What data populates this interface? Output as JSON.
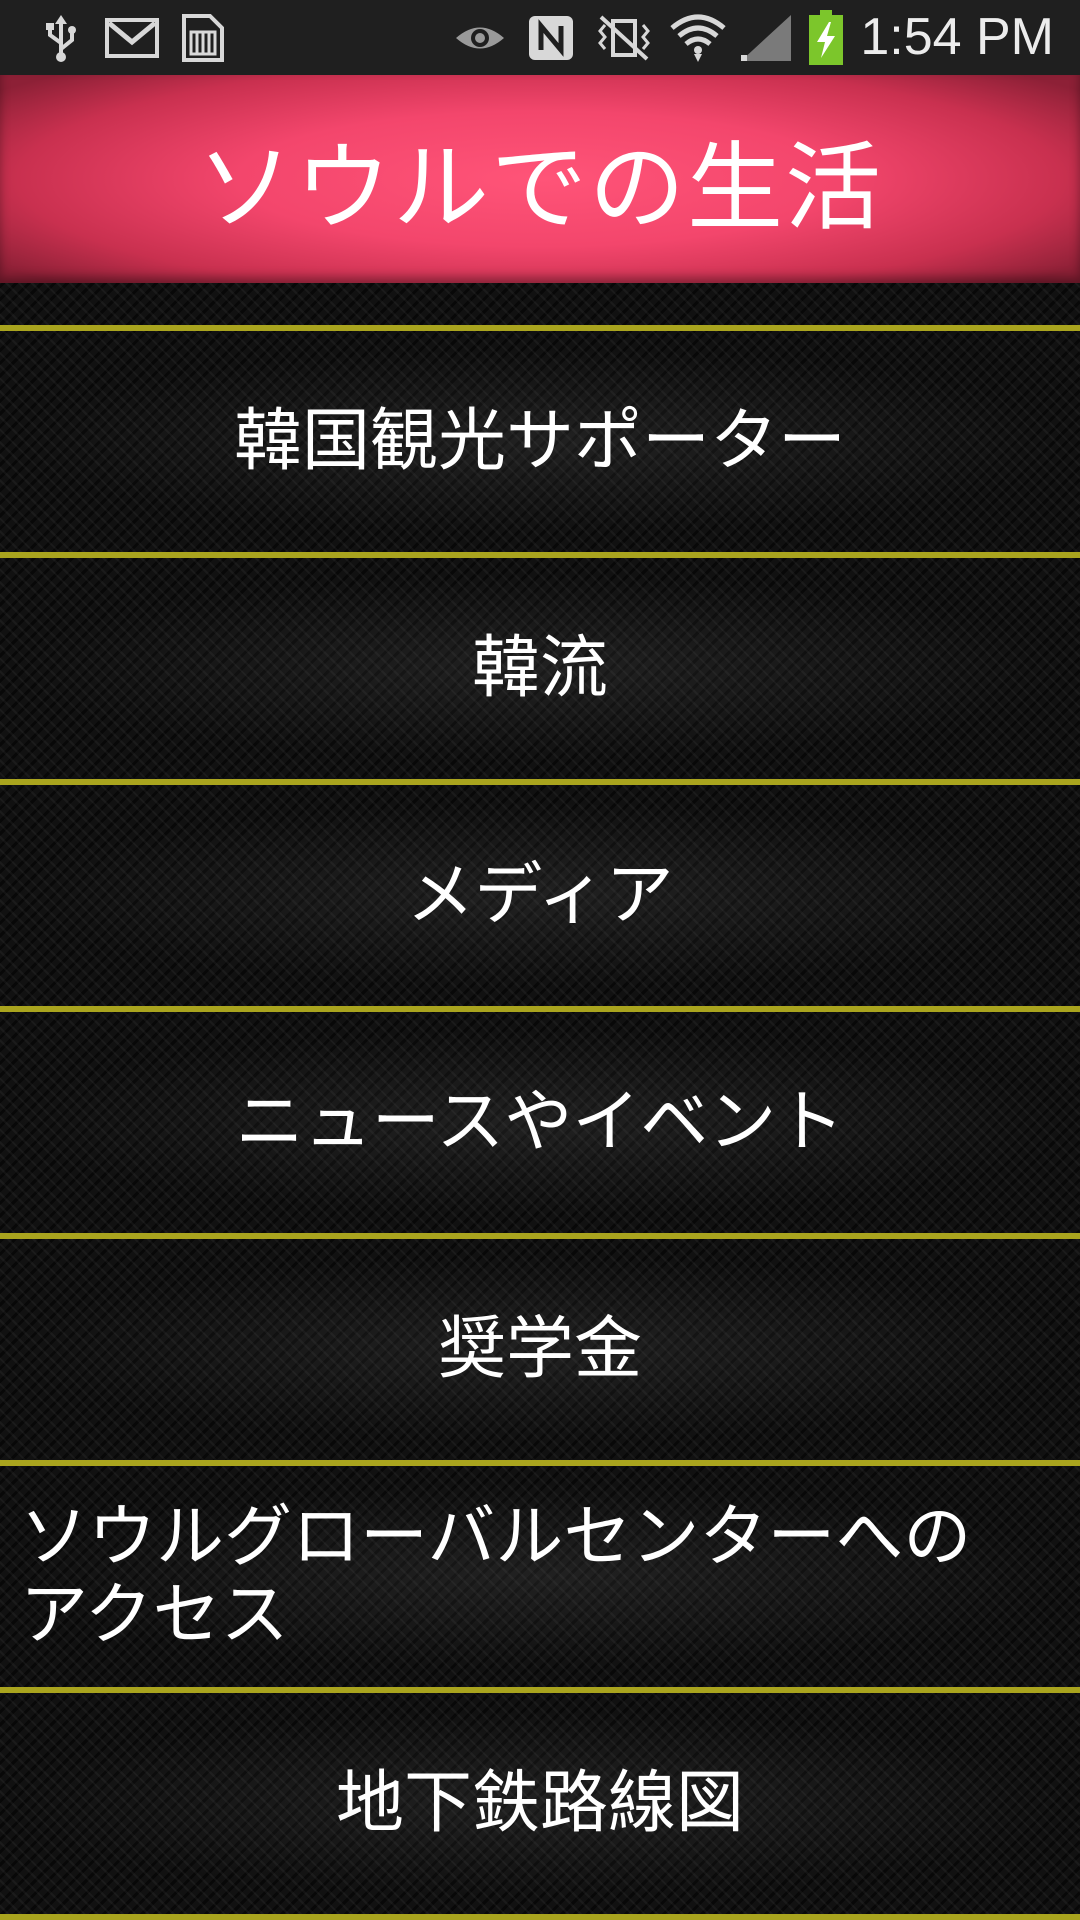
{
  "status_bar": {
    "time": "1:54 PM",
    "icons": [
      "usb-icon",
      "gmail-icon",
      "sim-card-icon",
      "eye-icon",
      "nfc-icon",
      "vibrate-mute-icon",
      "wifi-icon",
      "signal-icon",
      "battery-charging-icon"
    ],
    "battery_color": "#7cc62b"
  },
  "header": {
    "title": "ソウルでの生活",
    "background_color": "#ff5478"
  },
  "menu": {
    "divider_color": "#a9a41e",
    "items": [
      {
        "label": "韓国観光サポーター"
      },
      {
        "label": "韓流"
      },
      {
        "label": "メディア"
      },
      {
        "label": "ニュースやイベント"
      },
      {
        "label": "奨学金"
      },
      {
        "label": "ソウルグローバルセンターへのアクセス"
      },
      {
        "label": "地下鉄路線図"
      }
    ]
  }
}
